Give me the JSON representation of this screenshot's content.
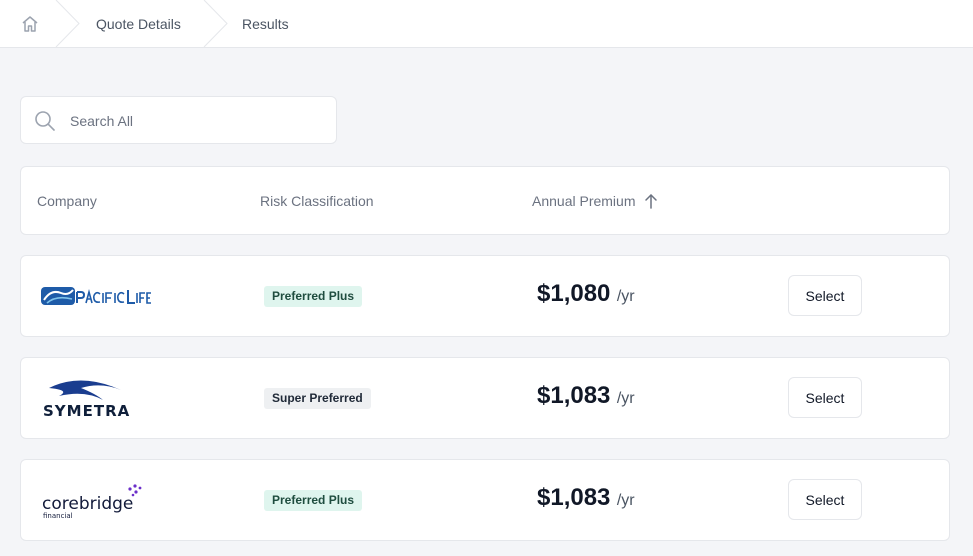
{
  "breadcrumb": {
    "home_icon": "home-icon",
    "items": [
      {
        "label": "Quote Details"
      },
      {
        "label": "Results"
      }
    ]
  },
  "search": {
    "placeholder": "Search All",
    "value": "",
    "icon": "search-icon"
  },
  "table": {
    "columns": [
      {
        "label": "Company"
      },
      {
        "label": "Risk Classification"
      },
      {
        "label": "Annual Premium",
        "sort": "ascending",
        "sort_icon": "arrow-up-icon"
      }
    ],
    "rows": [
      {
        "company_logo": "Pacific Life",
        "risk_class": "Preferred Plus",
        "premium": "$1,080",
        "unit": "/yr",
        "action": "Select",
        "badge_color": "#dff5ee"
      },
      {
        "company_logo": "SYMETRA",
        "risk_class": "Super Preferred",
        "premium": "$1,083",
        "unit": "/yr",
        "action": "Select",
        "badge_color": "#eef0f2"
      },
      {
        "company_logo": "corebridge financial",
        "risk_class": "Preferred Plus",
        "premium": "$1,083",
        "unit": "/yr",
        "action": "Select",
        "badge_color": "#dff5ee"
      }
    ]
  },
  "colors": {
    "background": "#f4f5f8",
    "card": "#ffffff",
    "border": "#e5e7eb",
    "badge_preferred_plus": "#dff5ee",
    "badge_super_preferred": "#eef0f2",
    "symetra_blue": "#1a3d8f",
    "corebridge_purple": "#6b2fc9"
  }
}
